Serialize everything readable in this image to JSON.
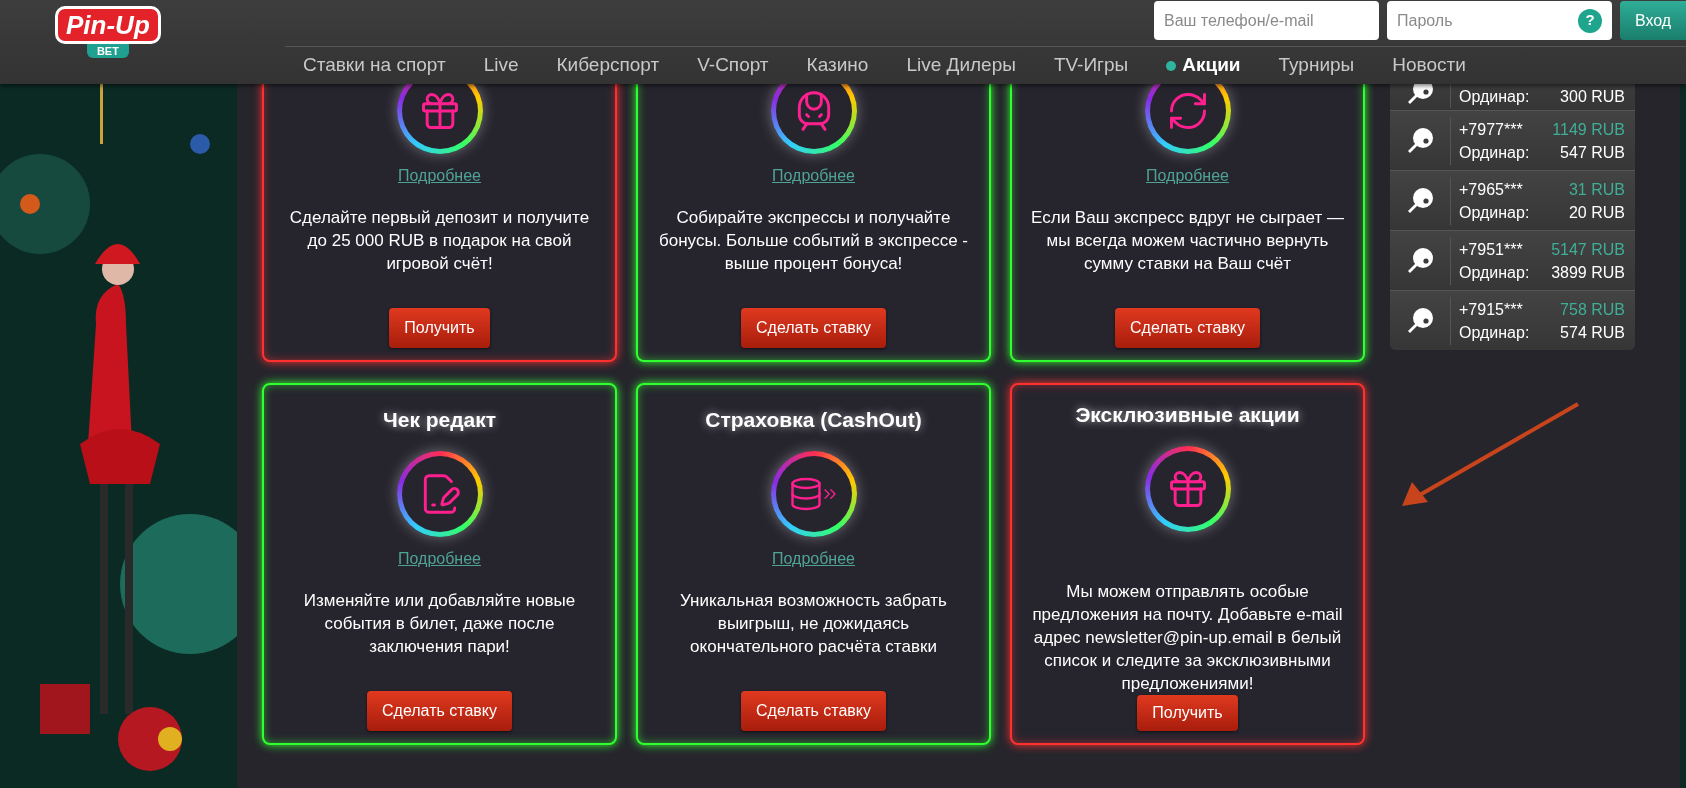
{
  "header": {
    "logo": {
      "name": "Pin-Up",
      "sub": "BET"
    },
    "login_field": {
      "placeholder": "Ваш телефон/e-mail"
    },
    "password_field": {
      "placeholder": "Пароль",
      "help": "?"
    },
    "login_button": "Вход"
  },
  "nav": [
    {
      "label": "Ставки на спорт",
      "selected": false
    },
    {
      "label": "Live",
      "selected": false
    },
    {
      "label": "Киберспорт",
      "selected": false
    },
    {
      "label": "V-Спорт",
      "selected": false
    },
    {
      "label": "Казино",
      "selected": false
    },
    {
      "label": "Live Дилеры",
      "selected": false
    },
    {
      "label": "TV-Игры",
      "selected": false
    },
    {
      "label": "Акции",
      "selected": true
    },
    {
      "label": "Турниры",
      "selected": false
    },
    {
      "label": "Новости",
      "selected": false
    }
  ],
  "promos": [
    {
      "color": "#ff3030",
      "link": "Подробнее",
      "text": "Сделайте первый депозит и получите до 25 000 RUB в подарок на свой игровой счёт!",
      "button": "Получить"
    },
    {
      "color": "#30ff30",
      "link": "Подробнее",
      "text": "Собирайте экспрессы и получайте бонусы. Больше событий в экспрессе - выше процент бонуса!",
      "button": "Сделать ставку"
    },
    {
      "color": "#30ff30",
      "link": "Подробнее",
      "text": "Если Ваш экспресс вдруг не сыграет — мы всегда можем частично вернуть сумму ставки на Ваш счёт",
      "button": "Сделать ставку"
    },
    {
      "title": "Чек редакт",
      "color": "#30ff30",
      "link": "Подробнее",
      "text": "Изменяйте или добавляйте новые события в билет, даже после заключения пари!",
      "button": "Сделать ставку"
    },
    {
      "title": "Страховка (CashOut)",
      "color": "#30ff30",
      "link": "Подробнее",
      "text": "Уникальная возможность забрать выигрыш, не дожидаясь окончательного расчёта ставки",
      "button": "Сделать ставку"
    },
    {
      "title": "Эксклюзивные акции",
      "color": "#ff3030",
      "text": "Мы можем отправлять особые предложения на почту. Добавьте e-mail адрес newsletter@pin-up.email в белый список и следите за эксклюзивными предложениями!",
      "button": "Получить"
    }
  ],
  "winners": [
    {
      "bet_type": "Ординар:",
      "stake": "300 RUB"
    },
    {
      "user": "+7977***",
      "win": "1149 RUB",
      "bet_type": "Ординар:",
      "stake": "547 RUB"
    },
    {
      "user": "+7965***",
      "win": "31 RUB",
      "bet_type": "Ординар:",
      "stake": "20 RUB"
    },
    {
      "user": "+7951***",
      "win": "5147 RUB",
      "bet_type": "Ординар:",
      "stake": "3899 RUB"
    },
    {
      "user": "+7915***",
      "win": "758 RUB",
      "bet_type": "Ординар:",
      "stake": "574 RUB"
    }
  ]
}
